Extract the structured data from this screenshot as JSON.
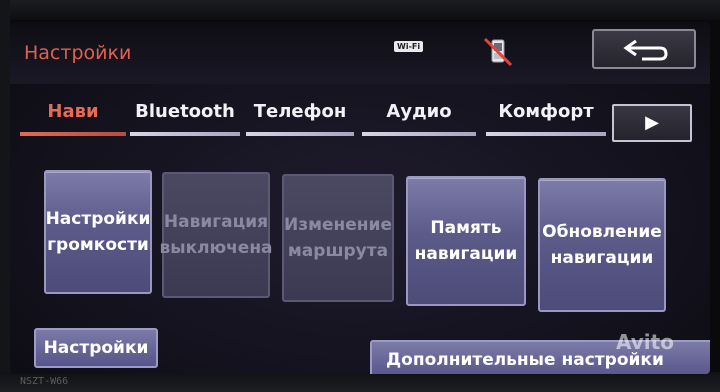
{
  "header": {
    "title": "Настройки",
    "wifi_label": "Wi-Fi",
    "phone_status_icon": "phone-disconnected-icon",
    "back_icon": "back-arrow-icon"
  },
  "tabs": [
    {
      "label": "Нави",
      "active": true
    },
    {
      "label": "Bluetooth",
      "active": false
    },
    {
      "label": "Телефон",
      "active": false
    },
    {
      "label": "Аудио",
      "active": false
    },
    {
      "label": "Комфорт",
      "active": false
    }
  ],
  "tabs_more_icon": "arrow-right-icon",
  "tiles": [
    {
      "label": "Настройки громкости",
      "line1": "Настройки",
      "line2": "громкости",
      "enabled": true
    },
    {
      "label": "Навигация выключена",
      "line1": "Навигация",
      "line2": "выключена",
      "enabled": false
    },
    {
      "label": "Изменение маршрута",
      "line1": "Изменение",
      "line2": "маршрута",
      "enabled": false
    },
    {
      "label": "Память навигации",
      "line1": "Память",
      "line2": "навигации",
      "enabled": true
    },
    {
      "label": "Обновление навигации",
      "line1": "Обновление",
      "line2": "навигации",
      "enabled": true
    }
  ],
  "bottom": {
    "settings_label": "Настройки",
    "advanced_label": "Дополнительные настройки"
  },
  "watermark": "Avito",
  "model_label": "NSZT-W66",
  "colors": {
    "title_accent": "#e2604f",
    "active_tab": "#e86a56",
    "button_face": "#6a6898"
  }
}
